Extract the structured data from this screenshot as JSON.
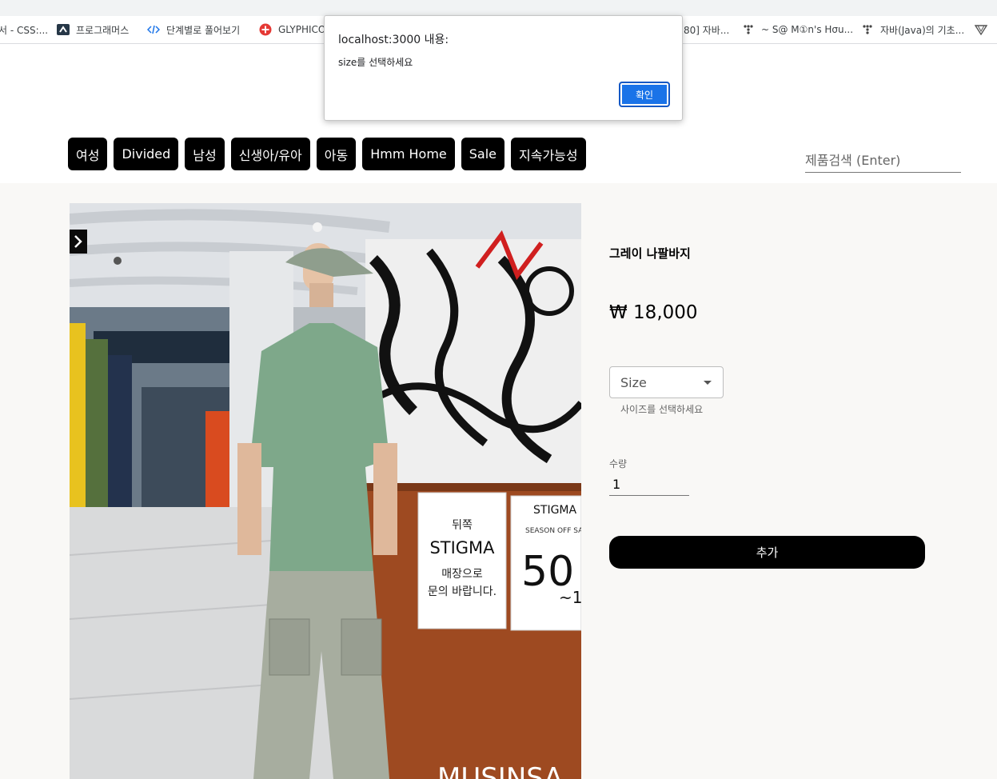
{
  "browser": {
    "bookmarks": [
      {
        "label": "서 - CSS:...",
        "icon": "page-icon"
      },
      {
        "label": "프로그래머스",
        "icon": "programmers-icon"
      },
      {
        "label": "단계별로 풀어보기",
        "icon": "code-icon"
      },
      {
        "label": "GLYPHICO",
        "icon": "glyphicon-icon"
      },
      {
        "label": "80] 자바...",
        "icon": "page-icon"
      },
      {
        "label": "~ S@ M①n's Hσu...",
        "icon": "dots-icon"
      },
      {
        "label": "자바(Java)의 기초...",
        "icon": "dots-icon"
      },
      {
        "label": "",
        "icon": "bookmark-icon"
      }
    ]
  },
  "alert": {
    "title": "localhost:3000 내용:",
    "message": "size를 선택하세요",
    "ok_label": "확인",
    "accent": "#1a73e8"
  },
  "nav": {
    "categories": [
      "여성",
      "Divided",
      "남성",
      "신생아/유아",
      "아동",
      "Hmm Home",
      "Sale",
      "지속가능성"
    ],
    "search_placeholder": "제품검색 (Enter)"
  },
  "product": {
    "title": "그레이 나팔바지",
    "price": "₩ 18,000",
    "size_label": "Size",
    "size_help": "사이즈를 선택하세요",
    "qty_label": "수량",
    "qty_value": "1",
    "add_label": "추가",
    "photo": {
      "sign_small": "뒤쪽",
      "sign_brand": "STIGMA",
      "sign_line1": "매장으로",
      "sign_line2": "문의 바랍니다.",
      "sign_brand2": "STIGMA",
      "sign_season": "SEASON OFF SA",
      "sign_pct": "50",
      "sign_tilde": "~1",
      "bottom_text": "MUSINSA"
    }
  }
}
